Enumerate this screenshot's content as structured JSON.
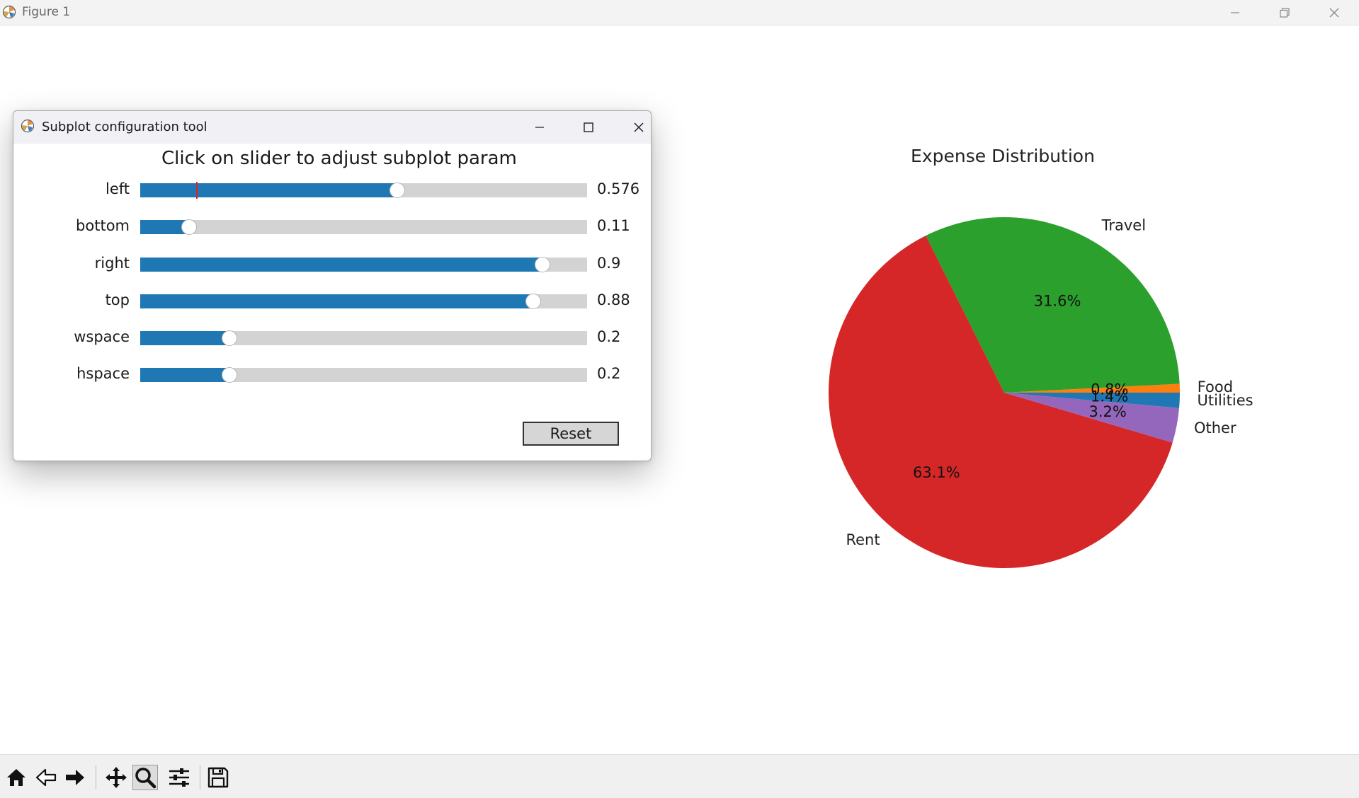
{
  "window": {
    "title": "Figure 1"
  },
  "dialog": {
    "title": "Subplot configuration tool",
    "heading": "Click on slider to adjust subplot param",
    "sliders": [
      {
        "label": "left",
        "value": "0.576",
        "fraction": 0.576,
        "marker": 0.125
      },
      {
        "label": "bottom",
        "value": "0.11",
        "fraction": 0.11
      },
      {
        "label": "right",
        "value": "0.9",
        "fraction": 0.9
      },
      {
        "label": "top",
        "value": "0.88",
        "fraction": 0.88
      },
      {
        "label": "wspace",
        "value": "0.2",
        "fraction": 0.2
      },
      {
        "label": "hspace",
        "value": "0.2",
        "fraction": 0.2
      }
    ],
    "reset_label": "Reset"
  },
  "chart_data": {
    "type": "pie",
    "title": "Expense Distribution",
    "start_angle_deg": 0,
    "direction": "counterclockwise",
    "slices": [
      {
        "label": "Food",
        "pct_label": "0.8%",
        "value": 0.8,
        "color": "#ff7f0e"
      },
      {
        "label": "Travel",
        "pct_label": "31.6%",
        "value": 31.6,
        "color": "#2ca02c"
      },
      {
        "label": "Rent",
        "pct_label": "63.1%",
        "value": 63.1,
        "color": "#d62728"
      },
      {
        "label": "Other",
        "pct_label": "3.2%",
        "value": 3.2,
        "color": "#9467bd"
      },
      {
        "label": "Utilities",
        "pct_label": "1.4%",
        "value": 1.4,
        "color": "#1f77b4"
      }
    ]
  },
  "toolbar": {
    "buttons": [
      "home-icon",
      "back-icon",
      "forward-icon",
      "pan-icon",
      "zoom-icon",
      "configure-subplots-icon",
      "save-icon"
    ]
  }
}
